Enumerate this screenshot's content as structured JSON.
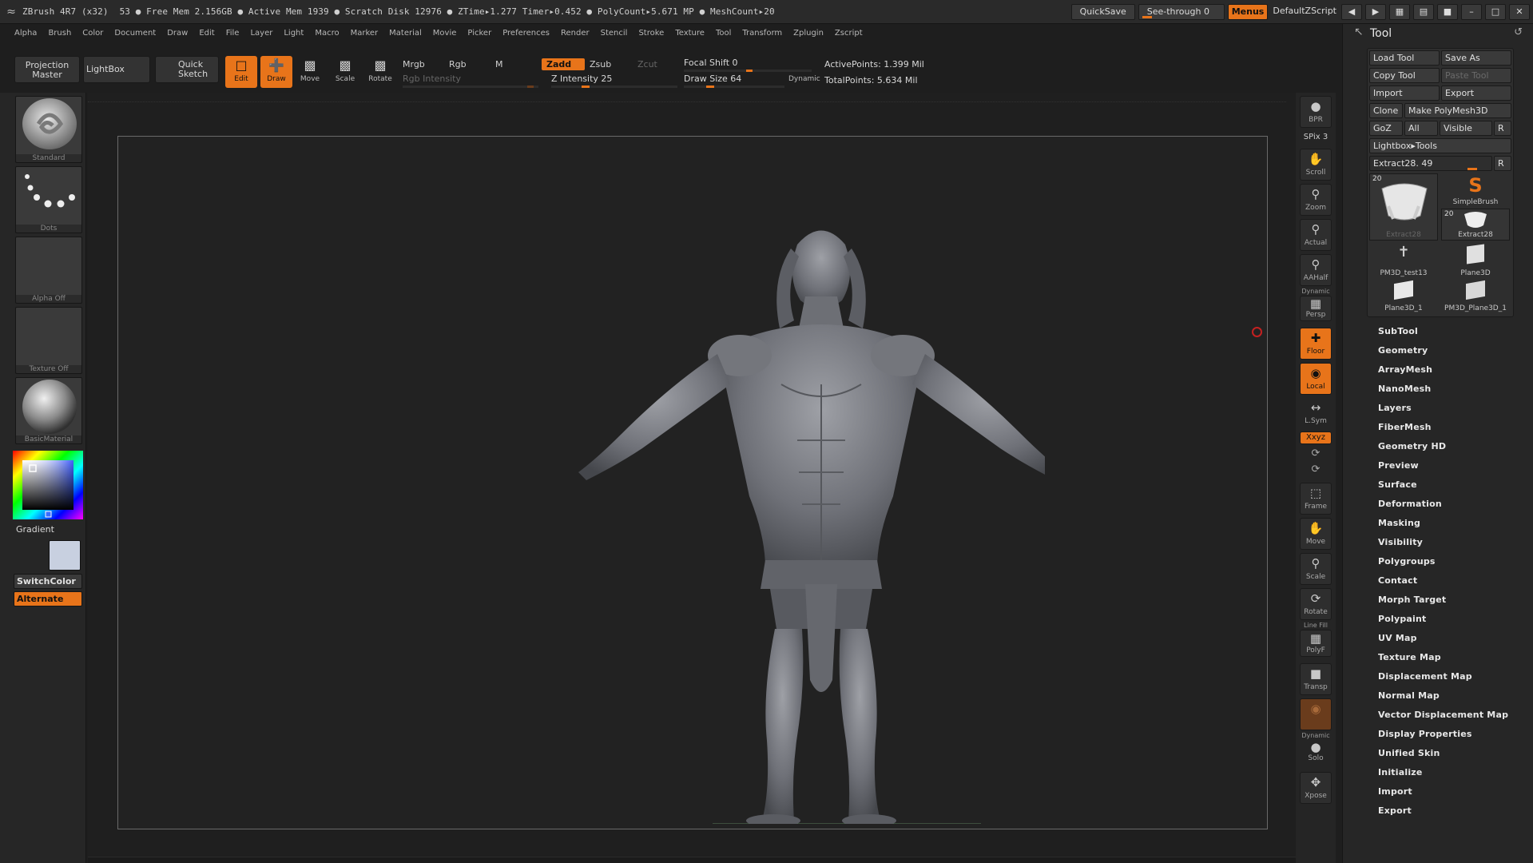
{
  "titlebar": {
    "app": "ZBrush 4R7 (x32)",
    "status": "53   ● Free Mem 2.156GB ● Active Mem 1939 ● Scratch Disk 12976 ●  ZTime▸1.277  Timer▸0.452 ● PolyCount▸5.671  MP  ●  MeshCount▸20",
    "quicksave": "QuickSave",
    "seethrough": "See-through  0",
    "menus": "Menus",
    "zscript": "DefaultZScript"
  },
  "menubar": [
    "Alpha",
    "Brush",
    "Color",
    "Document",
    "Draw",
    "Edit",
    "File",
    "Layer",
    "Light",
    "Macro",
    "Marker",
    "Material",
    "Movie",
    "Picker",
    "Preferences",
    "Render",
    "Stencil",
    "Stroke",
    "Texture",
    "Tool",
    "Transform",
    "Zplugin",
    "Zscript"
  ],
  "shelf": {
    "projection_master": "Projection Master",
    "lightbox": "LightBox",
    "quick_sketch": "Quick Sketch",
    "edit": "Edit",
    "draw": "Draw",
    "move": "Move",
    "scale": "Scale",
    "rotate": "Rotate",
    "mrgb": "Mrgb",
    "rgb": "Rgb",
    "m": "M",
    "rgb_intensity": "Rgb Intensity",
    "zadd": "Zadd",
    "zsub": "Zsub",
    "zcut": "Zcut",
    "z_intensity": "Z Intensity 25",
    "z_intensity_value": 25,
    "focal_shift": "Focal Shift 0",
    "draw_size": "Draw Size 64",
    "draw_size_value": 64,
    "dynamic": "Dynamic",
    "active_points": "ActivePoints: 1.399 Mil",
    "total_points": "TotalPoints: 5.634 Mil"
  },
  "leftpanel": {
    "brush": "Standard",
    "stroke": "Dots",
    "alpha": "Alpha  Off",
    "texture": "Texture  Off",
    "material": "BasicMaterial",
    "gradient": "Gradient",
    "switchcolor": "SwitchColor",
    "alternate": "Alternate",
    "colors": {
      "accent": "#e8741a",
      "secondary_swatch": "#c8d0e0"
    }
  },
  "rtools": {
    "bpr": "BPR",
    "spix": "SPix 3",
    "scroll": "Scroll",
    "zoom": "Zoom",
    "actual": "Actual",
    "aahalf": "AAHalf",
    "dynamic": "Dynamic",
    "persp": "Persp",
    "floor": "Floor",
    "local": "Local",
    "lsym": "L.Sym",
    "xyz": "Xxyz",
    "frame": "Frame",
    "move": "Move",
    "scale": "Scale",
    "rotate": "Rotate",
    "linefill": "Line Fill",
    "polyf": "PolyF",
    "transp": "Transp",
    "dynamic2": "Dynamic",
    "solo": "Solo",
    "xpose": "Xpose"
  },
  "rpanel": {
    "title": "Tool",
    "load_tool": "Load Tool",
    "save_as": "Save As",
    "copy_tool": "Copy Tool",
    "paste_tool": "Paste Tool",
    "import": "Import",
    "export": "Export",
    "clone": "Clone",
    "make_polymesh": "Make PolyMesh3D",
    "goz": "GoZ",
    "all": "All",
    "visible": "Visible",
    "r": "R",
    "lightbox_tools": "Lightbox▸Tools",
    "extract": "Extract28. 49",
    "thumbs": {
      "t1_num": "20",
      "t1": "Extract28",
      "t2": "SimpleBrush",
      "t3_num": "20",
      "t3": "Extract28",
      "t4": "PM3D_test13",
      "t5": "Plane3D",
      "t6": "Plane3D_1",
      "t7": "PM3D_Plane3D_1"
    },
    "sections": [
      "SubTool",
      "Geometry",
      "ArrayMesh",
      "NanoMesh",
      "Layers",
      "FiberMesh",
      "Geometry HD",
      "Preview",
      "Surface",
      "Deformation",
      "Masking",
      "Visibility",
      "Polygroups",
      "Contact",
      "Morph Target",
      "Polypaint",
      "UV Map",
      "Texture Map",
      "Displacement Map",
      "Normal Map",
      "Vector Displacement Map",
      "Display Properties",
      "Unified Skin",
      "Initialize",
      "Import",
      "Export"
    ]
  }
}
